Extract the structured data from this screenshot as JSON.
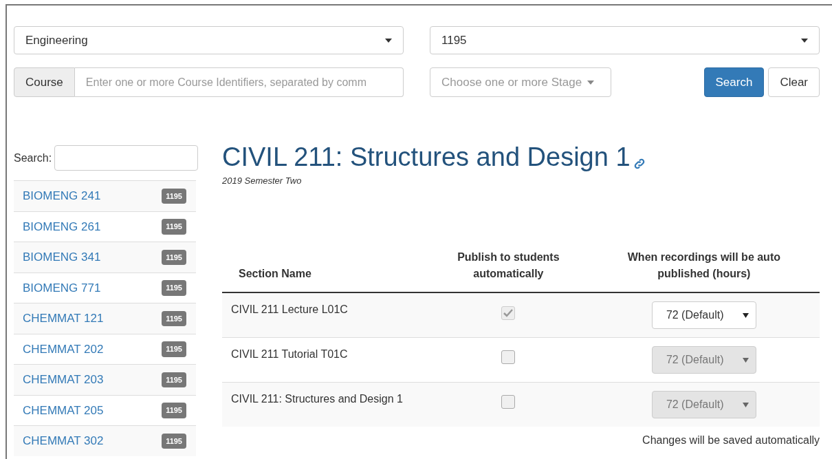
{
  "filters": {
    "faculty": {
      "value": "Engineering"
    },
    "term": {
      "value": "1195"
    },
    "course": {
      "label": "Course",
      "placeholder": "Enter one or more Course Identifiers, separated by comm"
    },
    "stages": {
      "placeholder": "Choose one or more Stage"
    },
    "buttons": [
      {
        "label": "Search",
        "kind": "primary"
      },
      {
        "label": "Clear",
        "kind": "default"
      }
    ]
  },
  "sidebar": {
    "search_label": "Search:",
    "items": [
      {
        "name": "BIOMENG 241",
        "badge": "1195"
      },
      {
        "name": "BIOMENG 261",
        "badge": "1195"
      },
      {
        "name": "BIOMENG 341",
        "badge": "1195"
      },
      {
        "name": "BIOMENG 771",
        "badge": "1195"
      },
      {
        "name": "CHEMMAT 121",
        "badge": "1195"
      },
      {
        "name": "CHEMMAT 202",
        "badge": "1195"
      },
      {
        "name": "CHEMMAT 203",
        "badge": "1195"
      },
      {
        "name": "CHEMMAT 205",
        "badge": "1195"
      },
      {
        "name": "CHEMMAT 302",
        "badge": "1195"
      }
    ]
  },
  "course": {
    "title": "CIVIL 211: Structures and Design 1",
    "subtitle": "2019 Semester Two"
  },
  "table": {
    "columns": [
      "Section Name",
      "Publish to students automatically",
      "When recordings will be auto published (hours)"
    ],
    "rows": [
      {
        "section": "CIVIL 211 Lecture L01C",
        "publish": {
          "checked": true,
          "disabled": true
        },
        "hours": {
          "value": "72 (Default)",
          "disabled": false
        }
      },
      {
        "section": "CIVIL 211 Tutorial T01C",
        "publish": {
          "checked": false,
          "disabled": false
        },
        "hours": {
          "value": "72 (Default)",
          "disabled": true
        }
      },
      {
        "section": "CIVIL 211: Structures and Design 1",
        "publish": {
          "checked": false,
          "disabled": false
        },
        "hours": {
          "value": "72 (Default)",
          "disabled": true
        }
      }
    ]
  },
  "footer_note": "Changes will be saved automatically"
}
